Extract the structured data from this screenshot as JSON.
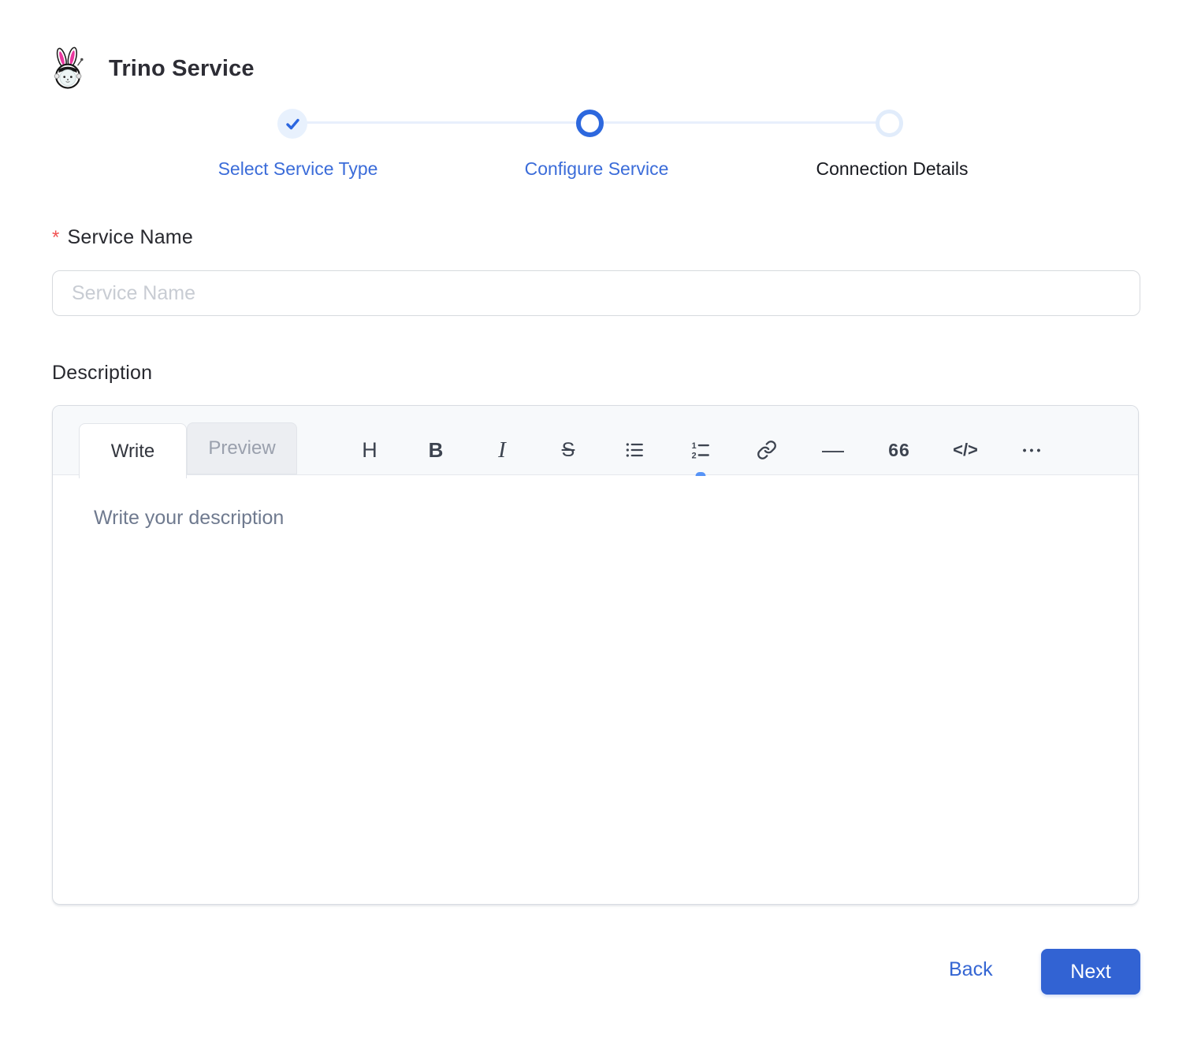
{
  "header": {
    "title": "Trino Service",
    "logo_icon": "trino-bunny-logo"
  },
  "stepper": {
    "steps": [
      {
        "label": "Select Service Type",
        "state": "completed",
        "icon": "check-icon"
      },
      {
        "label": "Configure Service",
        "state": "active",
        "icon": "ring-icon"
      },
      {
        "label": "Connection Details",
        "state": "upcoming",
        "icon": "ring-icon"
      }
    ]
  },
  "form": {
    "service_name": {
      "required_marker": "*",
      "label": "Service Name",
      "placeholder": "Service Name",
      "value": ""
    },
    "description": {
      "label": "Description"
    }
  },
  "editor": {
    "tabs": [
      {
        "label": "Write",
        "active": true
      },
      {
        "label": "Preview",
        "active": false
      }
    ],
    "toolbar": [
      {
        "name": "heading-icon",
        "glyph": "H"
      },
      {
        "name": "bold-icon",
        "glyph": "B"
      },
      {
        "name": "italic-icon",
        "glyph": "I"
      },
      {
        "name": "strikethrough-icon",
        "glyph": "S"
      },
      {
        "name": "bullet-list-icon"
      },
      {
        "name": "numbered-list-icon"
      },
      {
        "name": "link-icon"
      },
      {
        "name": "horizontal-rule-icon",
        "glyph": "—"
      },
      {
        "name": "quote-icon",
        "glyph": "66"
      },
      {
        "name": "code-icon",
        "glyph": "</>"
      },
      {
        "name": "more-icon",
        "glyph": "•••"
      }
    ],
    "placeholder": "Write your description",
    "value": ""
  },
  "footer": {
    "back_label": "Back",
    "next_label": "Next"
  },
  "colors": {
    "accent_blue": "#3263d3",
    "step_label_blue": "#3b6cd9",
    "step_completed_bg": "#e8f1fd",
    "step_upcoming_ring": "#e1ecfb",
    "required_red": "#f25353",
    "editor_header_bg": "#f7f9fb",
    "placeholder_gray": "#c8ccd3",
    "editor_placeholder_slate": "#6f7a8f"
  }
}
